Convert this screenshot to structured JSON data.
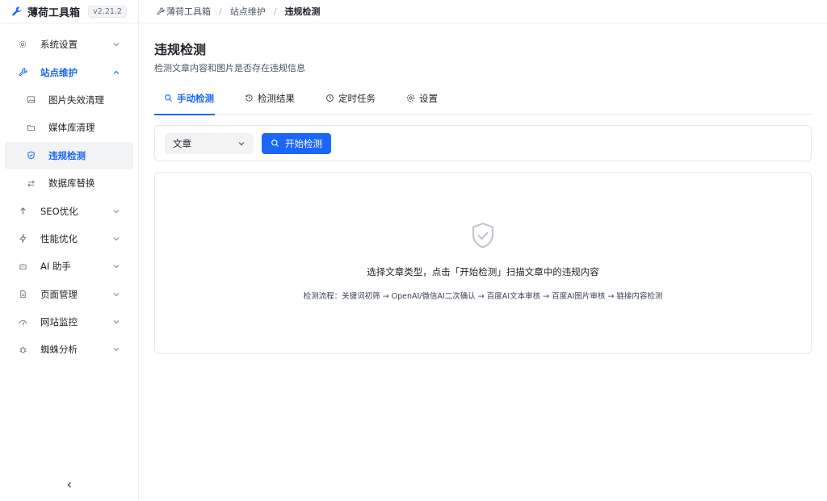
{
  "brand": {
    "name": "薄荷工具箱",
    "version": "v2.21.2"
  },
  "sidebar": {
    "items": [
      {
        "label": "系统设置",
        "icon": "gear-icon"
      },
      {
        "label": "站点维护",
        "icon": "wrench-icon"
      },
      {
        "label": "图片失效清理",
        "icon": "image-icon"
      },
      {
        "label": "媒体库清理",
        "icon": "folder-icon"
      },
      {
        "label": "违规检测",
        "icon": "shield-icon"
      },
      {
        "label": "数据库替换",
        "icon": "swap-icon"
      },
      {
        "label": "SEO优化",
        "icon": "arrow-up-icon"
      },
      {
        "label": "性能优化",
        "icon": "bolt-icon"
      },
      {
        "label": "AI 助手",
        "icon": "robot-icon"
      },
      {
        "label": "页面管理",
        "icon": "file-icon"
      },
      {
        "label": "网站监控",
        "icon": "monitor-icon"
      },
      {
        "label": "蜘蛛分析",
        "icon": "bug-icon"
      }
    ]
  },
  "breadcrumb": {
    "root": "薄荷工具箱",
    "parent": "站点维护",
    "current": "违规检测"
  },
  "page": {
    "title": "违规检测",
    "description": "检测文章内容和图片是否存在违规信息"
  },
  "tabs": [
    {
      "label": "手动检测",
      "icon": "search-icon"
    },
    {
      "label": "检测结果",
      "icon": "history-icon"
    },
    {
      "label": "定时任务",
      "icon": "clock-icon"
    },
    {
      "label": "设置",
      "icon": "gear-icon"
    }
  ],
  "toolbar": {
    "select_value": "文章",
    "start_label": "开始检测"
  },
  "empty": {
    "message": "选择文章类型，点击「开始检测」扫描文章中的违规内容",
    "flow": "检测流程：关键词初筛 → OpenAI/微信AI二次确认 → 百度AI文本审核 → 百度AI图片审核 → 链接内容检测"
  },
  "colors": {
    "accent": "#1a66ff",
    "border": "#e5e7eb",
    "muted_icon": "#c2c6cc"
  }
}
